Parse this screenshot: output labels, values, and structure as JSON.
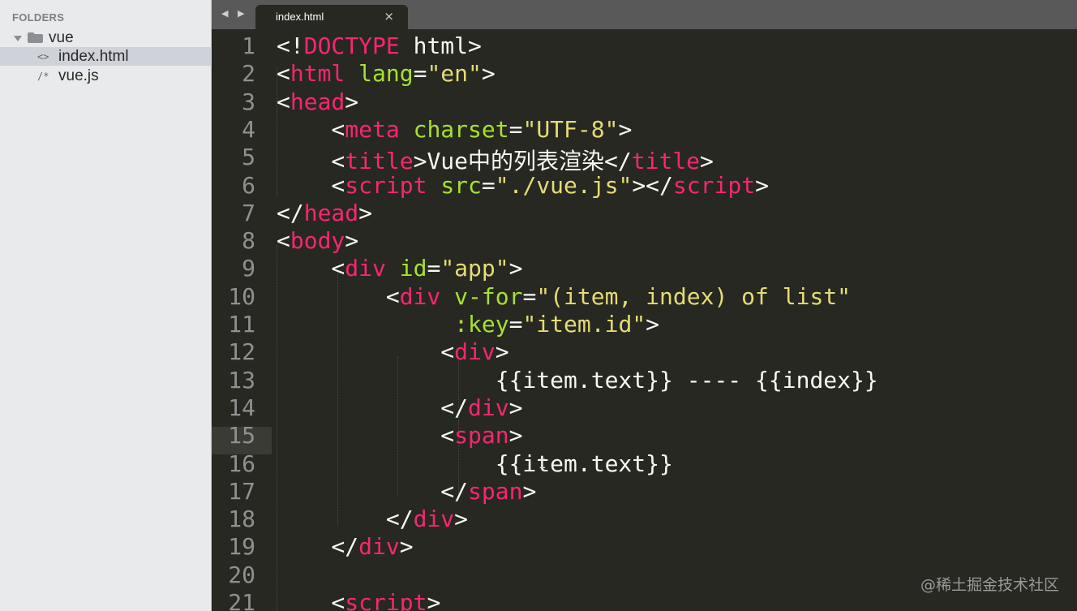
{
  "sidebar": {
    "header": "FOLDERS",
    "folder": "vue",
    "files": [
      {
        "glyph": "<>",
        "name": "index.html"
      },
      {
        "glyph": "/*",
        "name": "vue.js"
      }
    ]
  },
  "tabs": {
    "nav_arrows": "◀ ▶",
    "active_title": "index.html",
    "close_glyph": "×"
  },
  "editor": {
    "current_line": 15,
    "lines": [
      {
        "num": "1",
        "tokens": [
          [
            "<!",
            "w"
          ],
          [
            "DOCTYPE",
            "k"
          ],
          [
            " html>",
            "w"
          ]
        ]
      },
      {
        "num": "2",
        "tokens": [
          [
            "<",
            "w"
          ],
          [
            "html",
            "k"
          ],
          [
            " ",
            "w"
          ],
          [
            "lang",
            "a"
          ],
          [
            "=",
            "w"
          ],
          [
            "\"en\"",
            "s"
          ],
          [
            ">",
            "w"
          ]
        ]
      },
      {
        "num": "3",
        "tokens": [
          [
            "<",
            "w"
          ],
          [
            "head",
            "k"
          ],
          [
            ">",
            "w"
          ]
        ]
      },
      {
        "num": "4",
        "tokens": [
          [
            "    <",
            "w"
          ],
          [
            "meta",
            "k"
          ],
          [
            " ",
            "w"
          ],
          [
            "charset",
            "a"
          ],
          [
            "=",
            "w"
          ],
          [
            "\"UTF-8\"",
            "s"
          ],
          [
            ">",
            "w"
          ]
        ]
      },
      {
        "num": "5",
        "tokens": [
          [
            "    <",
            "w"
          ],
          [
            "title",
            "k"
          ],
          [
            ">Vue中的列表渲染</",
            "w"
          ],
          [
            "title",
            "k"
          ],
          [
            ">",
            "w"
          ]
        ]
      },
      {
        "num": "6",
        "tokens": [
          [
            "    <",
            "w"
          ],
          [
            "script",
            "k"
          ],
          [
            " ",
            "w"
          ],
          [
            "src",
            "a"
          ],
          [
            "=",
            "w"
          ],
          [
            "\"./vue.js\"",
            "s"
          ],
          [
            "></",
            "w"
          ],
          [
            "script",
            "k"
          ],
          [
            ">",
            "w"
          ]
        ]
      },
      {
        "num": "7",
        "tokens": [
          [
            "</",
            "w"
          ],
          [
            "head",
            "k"
          ],
          [
            ">",
            "w"
          ]
        ]
      },
      {
        "num": "8",
        "tokens": [
          [
            "<",
            "w"
          ],
          [
            "body",
            "k"
          ],
          [
            ">",
            "w"
          ]
        ]
      },
      {
        "num": "9",
        "tokens": [
          [
            "    <",
            "w"
          ],
          [
            "div",
            "k"
          ],
          [
            " ",
            "w"
          ],
          [
            "id",
            "a"
          ],
          [
            "=",
            "w"
          ],
          [
            "\"app\"",
            "s"
          ],
          [
            ">",
            "w"
          ]
        ]
      },
      {
        "num": "10",
        "tokens": [
          [
            "        <",
            "w"
          ],
          [
            "div",
            "k"
          ],
          [
            " ",
            "w"
          ],
          [
            "v-for",
            "a"
          ],
          [
            "=",
            "w"
          ],
          [
            "\"(item, index) of list\"",
            "s"
          ]
        ]
      },
      {
        "num": "11",
        "tokens": [
          [
            "             ",
            "w"
          ],
          [
            ":key",
            "a"
          ],
          [
            "=",
            "w"
          ],
          [
            "\"item.id\"",
            "s"
          ],
          [
            ">",
            "w"
          ]
        ]
      },
      {
        "num": "12",
        "tokens": [
          [
            "            <",
            "w"
          ],
          [
            "div",
            "k"
          ],
          [
            ">",
            "w"
          ]
        ]
      },
      {
        "num": "13",
        "tokens": [
          [
            "                {{item.text}} ---- {{index}}",
            "w"
          ]
        ]
      },
      {
        "num": "14",
        "tokens": [
          [
            "            </",
            "w"
          ],
          [
            "div",
            "k"
          ],
          [
            ">",
            "w"
          ]
        ]
      },
      {
        "num": "15",
        "tokens": [
          [
            "            <",
            "w"
          ],
          [
            "span",
            "k"
          ],
          [
            ">",
            "w"
          ]
        ]
      },
      {
        "num": "16",
        "tokens": [
          [
            "                {{item.text}}",
            "w"
          ]
        ]
      },
      {
        "num": "17",
        "tokens": [
          [
            "            </",
            "w"
          ],
          [
            "span",
            "k"
          ],
          [
            ">",
            "w"
          ]
        ]
      },
      {
        "num": "18",
        "tokens": [
          [
            "        </",
            "w"
          ],
          [
            "div",
            "k"
          ],
          [
            ">",
            "w"
          ]
        ]
      },
      {
        "num": "19",
        "tokens": [
          [
            "    </",
            "w"
          ],
          [
            "div",
            "k"
          ],
          [
            ">",
            "w"
          ]
        ]
      },
      {
        "num": "20",
        "tokens": []
      },
      {
        "num": "21",
        "tokens": [
          [
            "    <",
            "w"
          ],
          [
            "script",
            "k"
          ],
          [
            ">",
            "w"
          ]
        ]
      }
    ]
  },
  "watermark": "@稀土掘金技术社区",
  "colors": {
    "background": "#272822",
    "text": "#f8f8f2",
    "tag": "#f92672",
    "attribute": "#a6e22e",
    "string": "#e6db74",
    "gutter_number": "#909090"
  }
}
